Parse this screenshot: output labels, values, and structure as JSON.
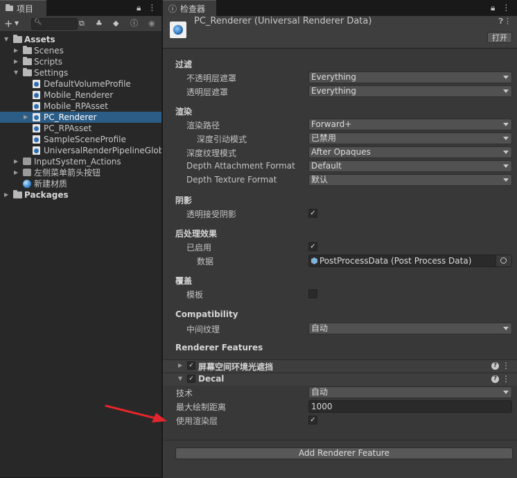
{
  "project_panel": {
    "tab_label": "项目",
    "search": {
      "value": "",
      "placeholder": ""
    },
    "tree": [
      {
        "label": "Assets",
        "depth": 0,
        "type": "folder",
        "expanded": true,
        "bold": true
      },
      {
        "label": "Scenes",
        "depth": 1,
        "type": "folder",
        "expanded": false
      },
      {
        "label": "Scripts",
        "depth": 1,
        "type": "folder",
        "expanded": false
      },
      {
        "label": "Settings",
        "depth": 1,
        "type": "folder",
        "expanded": true
      },
      {
        "label": "DefaultVolumeProfile",
        "depth": 2,
        "type": "asset"
      },
      {
        "label": "Mobile_Renderer",
        "depth": 2,
        "type": "asset"
      },
      {
        "label": "Mobile_RPAsset",
        "depth": 2,
        "type": "asset"
      },
      {
        "label": "PC_Renderer",
        "depth": 2,
        "type": "asset",
        "selected": true,
        "expandable": true
      },
      {
        "label": "PC_RPAsset",
        "depth": 2,
        "type": "asset"
      },
      {
        "label": "SampleSceneProfile",
        "depth": 2,
        "type": "asset"
      },
      {
        "label": "UniversalRenderPipelineGloba",
        "depth": 2,
        "type": "asset"
      },
      {
        "label": "InputSystem_Actions",
        "depth": 1,
        "type": "input",
        "expandable": true
      },
      {
        "label": "左侧菜单箭头按钮",
        "depth": 1,
        "type": "scene",
        "expandable": true
      },
      {
        "label": "新建材质",
        "depth": 1,
        "type": "material"
      },
      {
        "label": "Packages",
        "depth": 0,
        "type": "folder",
        "expanded": false,
        "bold": true
      }
    ]
  },
  "inspector": {
    "tab_label": "检查器",
    "header_title": "PC_Renderer (Universal Renderer Data)",
    "open_button": "打开",
    "sections": {
      "filtering": {
        "title": "过滤",
        "opaque_mask_label": "不透明层遮罩",
        "opaque_mask_value": "Everything",
        "transparent_mask_label": "透明层遮罩",
        "transparent_mask_value": "Everything"
      },
      "rendering": {
        "title": "渲染",
        "path_label": "渲染路径",
        "path_value": "Forward+",
        "depth_priming_label": "深度引动模式",
        "depth_priming_value": "已禁用",
        "depth_texture_mode_label": "深度纹理模式",
        "depth_texture_mode_value": "After Opaques",
        "depth_attachment_label": "Depth Attachment Format",
        "depth_attachment_value": "Default",
        "depth_texture_format_label": "Depth Texture Format",
        "depth_texture_format_value": "默认"
      },
      "shadows": {
        "title": "阴影",
        "transparent_receive_label": "透明接受阴影",
        "transparent_receive_checked": true
      },
      "post_processing": {
        "title": "后处理效果",
        "enabled_label": "已启用",
        "enabled_checked": true,
        "data_label": "数据",
        "data_value": "PostProcessData (Post Process Data)"
      },
      "overrides": {
        "title": "覆盖",
        "stencil_label": "模板",
        "stencil_checked": false
      },
      "compatibility": {
        "title": "Compatibility",
        "intermediate_label": "中间纹理",
        "intermediate_value": "自动"
      },
      "renderer_features": {
        "title": "Renderer Features",
        "ssao_label": "屏幕空间环境光遮挡",
        "ssao_enabled": true,
        "decal_label": "Decal",
        "decal_enabled": true,
        "technique_label": "技术",
        "technique_value": "自动",
        "max_draw_label": "最大绘制距离",
        "max_draw_value": "1000",
        "use_layers_label": "使用渲染层",
        "use_layers_checked": true
      }
    },
    "add_feature_button": "Add Renderer Feature"
  },
  "colors": {
    "selection": "#2c5d87",
    "annotation_arrow": "#e3262b"
  }
}
